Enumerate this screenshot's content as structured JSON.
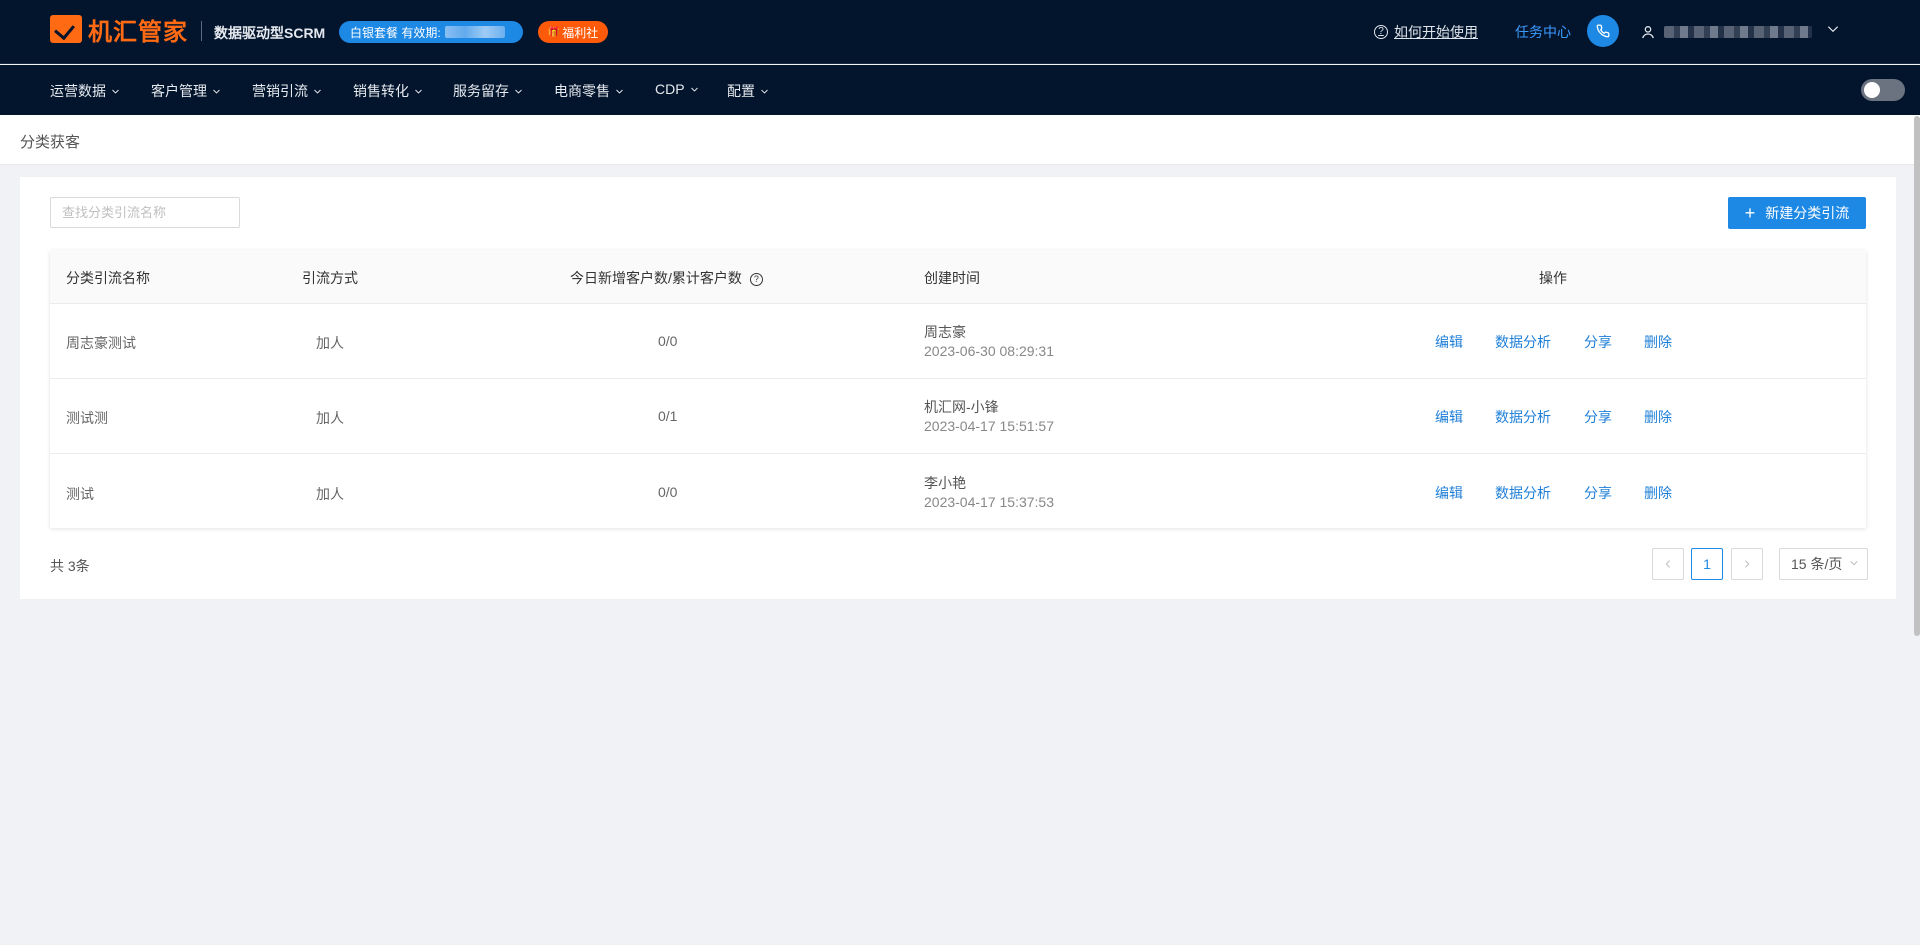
{
  "header": {
    "logo_text": "机汇管家",
    "tagline": "数据驱动型SCRM",
    "plan_label": "白银套餐 有效期:",
    "welfare_label": "福利社",
    "help_label": "如何开始使用",
    "task_center_label": "任务中心"
  },
  "nav": {
    "items": [
      {
        "label": "运营数据"
      },
      {
        "label": "客户管理"
      },
      {
        "label": "营销引流"
      },
      {
        "label": "销售转化"
      },
      {
        "label": "服务留存"
      },
      {
        "label": "电商零售"
      },
      {
        "label": "CDP"
      },
      {
        "label": "配置"
      }
    ]
  },
  "page": {
    "title": "分类获客"
  },
  "search": {
    "placeholder": "查找分类引流名称",
    "value": ""
  },
  "toolbar": {
    "new_label": "新建分类引流"
  },
  "table": {
    "headers": {
      "name": "分类引流名称",
      "method": "引流方式",
      "count": "今日新增客户数/累计客户数",
      "created": "创建时间",
      "actions": "操作"
    },
    "rows": [
      {
        "name": "周志豪测试",
        "method": "加人",
        "count": "0/0",
        "creator": "周志豪",
        "time": "2023-06-30 08:29:31"
      },
      {
        "name": "测试测",
        "method": "加人",
        "count": "0/1",
        "creator": "机汇网-小锋",
        "time": "2023-04-17 15:51:57"
      },
      {
        "name": "测试",
        "method": "加人",
        "count": "0/0",
        "creator": "李小艳",
        "time": "2023-04-17 15:37:53"
      }
    ],
    "actions": {
      "edit": "编辑",
      "analytics": "数据分析",
      "share": "分享",
      "delete": "删除"
    }
  },
  "pagination": {
    "total_label": "共 3条",
    "current_page": "1",
    "page_size_label": "15 条/页"
  },
  "colors": {
    "header_bg": "#03152c",
    "brand_orange": "#ff6a13",
    "primary_blue": "#1e88e5",
    "link_blue": "#1e7fd8"
  }
}
